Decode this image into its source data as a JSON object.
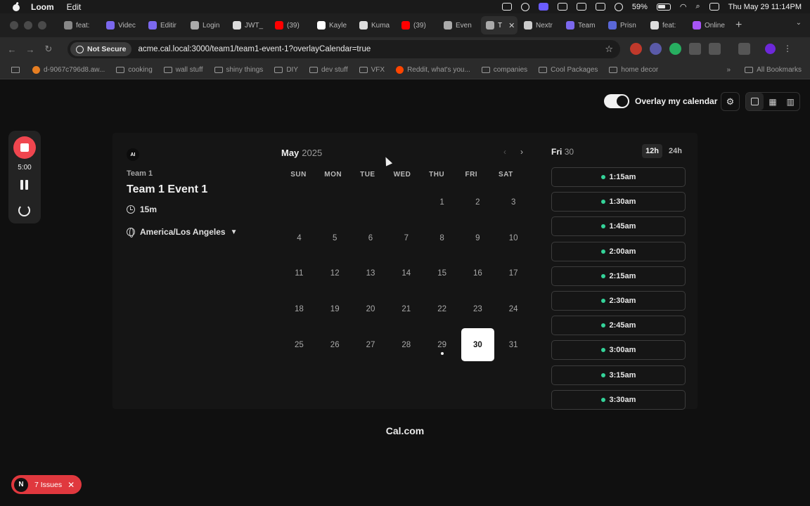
{
  "menubar": {
    "app": "Loom",
    "menu": [
      "Edit"
    ],
    "battery": "59%",
    "datetime": "Thu May 29  11:14PM"
  },
  "tabs": [
    {
      "label": "feat:",
      "color": "#888888"
    },
    {
      "label": "Videc",
      "color": "#7b68ee"
    },
    {
      "label": "Editir",
      "color": "#7b68ee"
    },
    {
      "label": "Login",
      "color": "#aaaaaa"
    },
    {
      "label": "JWT_",
      "color": "#dddddd"
    },
    {
      "label": "(39)",
      "color": "#ff0000"
    },
    {
      "label": "Kayle",
      "color": "#ffffff"
    },
    {
      "label": "Kuma",
      "color": "#dddddd"
    },
    {
      "label": "(39)",
      "color": "#ff0000"
    },
    {
      "label": "Even",
      "color": "#aaaaaa"
    },
    {
      "label": "T",
      "color": "#aaaaaa",
      "active": true
    },
    {
      "label": "Nextr",
      "color": "#cccccc"
    },
    {
      "label": "Team",
      "color": "#7b68ee"
    },
    {
      "label": "Prisn",
      "color": "#5a67d8"
    },
    {
      "label": "feat:",
      "color": "#dddddd"
    },
    {
      "label": "Online",
      "color": "#a855f7"
    }
  ],
  "address": {
    "security": "Not Secure",
    "url": "acme.cal.local:3000/team1/team1-event-1?overlayCalendar=true"
  },
  "bookmarks": [
    {
      "label": "d-9067c796d8.aw...",
      "type": "site",
      "color": "#e67e22"
    },
    {
      "label": "cooking",
      "type": "folder"
    },
    {
      "label": "wall stuff",
      "type": "folder"
    },
    {
      "label": "shiny things",
      "type": "folder"
    },
    {
      "label": "DIY",
      "type": "folder"
    },
    {
      "label": "dev stuff",
      "type": "folder"
    },
    {
      "label": "VFX",
      "type": "folder"
    },
    {
      "label": "Reddit, what's you...",
      "type": "site",
      "color": "#ff4500"
    },
    {
      "label": "companies",
      "type": "folder"
    },
    {
      "label": "Cool Packages",
      "type": "folder"
    },
    {
      "label": "home decor",
      "type": "folder"
    }
  ],
  "all_bookmarks": "All Bookmarks",
  "loom": {
    "time": "5:00"
  },
  "controls": {
    "overlay_label": "Overlay my calendar"
  },
  "event": {
    "avatar": "AI",
    "team": "Team 1",
    "title": "Team 1 Event 1",
    "duration": "15m",
    "timezone": "America/Los Angeles"
  },
  "calendar": {
    "month": "May",
    "year": "2025",
    "weekdays": [
      "SUN",
      "MON",
      "TUE",
      "WED",
      "THU",
      "FRI",
      "SAT"
    ],
    "days": [
      "",
      "",
      "",
      "",
      "1",
      "2",
      "3",
      "4",
      "5",
      "6",
      "7",
      "8",
      "9",
      "10",
      "11",
      "12",
      "13",
      "14",
      "15",
      "16",
      "17",
      "18",
      "19",
      "20",
      "21",
      "22",
      "23",
      "24",
      "25",
      "26",
      "27",
      "28",
      "29",
      "30",
      "31"
    ],
    "selected": "30",
    "today": "29"
  },
  "slots": {
    "day": "Fri",
    "date": "30",
    "format_12": "12h",
    "format_24": "24h",
    "times": [
      "1:15am",
      "1:30am",
      "1:45am",
      "2:00am",
      "2:15am",
      "2:30am",
      "2:45am",
      "3:00am",
      "3:15am",
      "3:30am"
    ]
  },
  "brand": "Cal.com",
  "issues": {
    "badge": "N",
    "label": "7 Issues"
  }
}
